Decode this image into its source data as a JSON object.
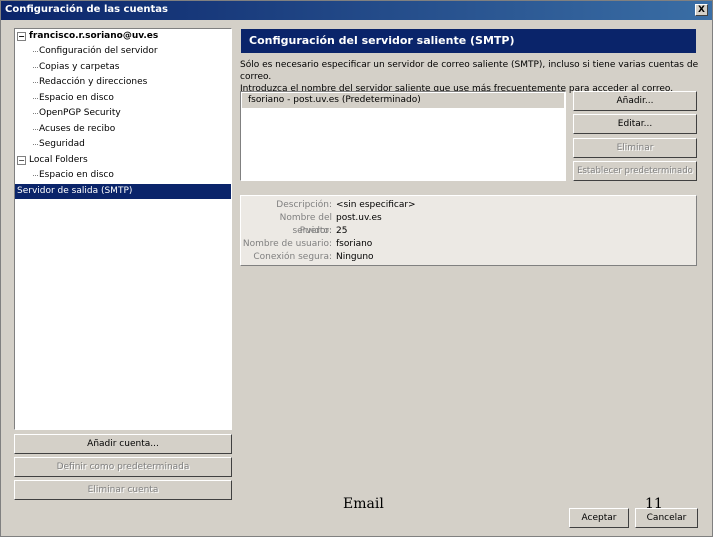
{
  "window": {
    "title": "Configuración de las cuentas",
    "close_label": "X"
  },
  "tree": {
    "account": "francisco.r.soriano@uv.es",
    "account_items": [
      "Configuración del servidor",
      "Copias y carpetas",
      "Redacción y direcciones",
      "Espacio en disco",
      "OpenPGP Security",
      "Acuses de recibo",
      "Seguridad"
    ],
    "local_folders": "Local Folders",
    "local_items": [
      "Espacio en disco"
    ],
    "selected": "Servidor de salida (SMTP)",
    "toggle_symbol": "−"
  },
  "left_buttons": {
    "add_account": "Añadir cuenta...",
    "set_default": "Definir como predeterminada",
    "remove_account": "Eliminar cuenta"
  },
  "main": {
    "heading": "Configuración del servidor saliente (SMTP)",
    "description_line1": "Sólo es necesario especificar un servidor de correo saliente (SMTP), incluso si tiene varias cuentas de correo.",
    "description_line2": "Introduzca el nombre del servidor saliente que use más frecuentemente para acceder al correo.",
    "servers": [
      "fsoriano - post.uv.es (Predeterminado)"
    ],
    "buttons": {
      "add": "Añadir...",
      "edit": "Editar...",
      "remove": "Eliminar",
      "set_default": "Establecer predeterminado"
    },
    "details": {
      "description_label": "Descripción:",
      "description_value": "<sin especificar>",
      "server_label": "Nombre del servidor:",
      "server_value": "post.uv.es",
      "port_label": "Puerto:",
      "port_value": "25",
      "user_label": "Nombre de usuario:",
      "user_value": "fsoriano",
      "security_label": "Conexión segura:",
      "security_value": "Ninguno"
    }
  },
  "footer": {
    "accept": "Aceptar",
    "cancel": "Cancelar",
    "slide_label": "Email",
    "page_number": "11"
  }
}
